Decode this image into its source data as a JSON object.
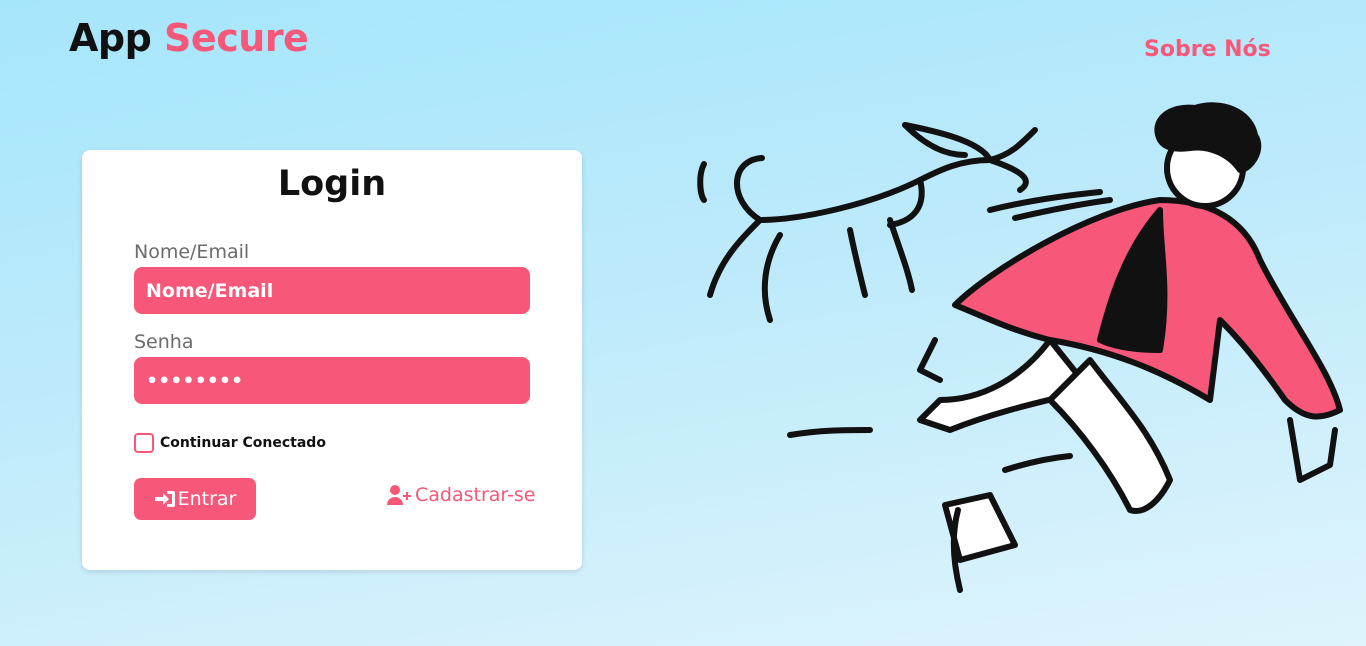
{
  "header": {
    "logo_part1": "App",
    "logo_part2": "Secure",
    "nav_about": "Sobre Nós"
  },
  "login": {
    "title": "Login",
    "username_label": "Nome/Email",
    "username_placeholder": "Nome/Email",
    "password_label": "Senha",
    "password_value": "********",
    "remember_label": "Continuar Conectado",
    "remember_checked": false,
    "submit_label": "Entrar",
    "register_label": "Cadastrar-se"
  },
  "icons": {
    "submit": "sign-in-icon",
    "register": "user-plus-icon"
  },
  "colors": {
    "accent": "#f75778",
    "background": "#b3e8fb",
    "text": "#111111"
  }
}
